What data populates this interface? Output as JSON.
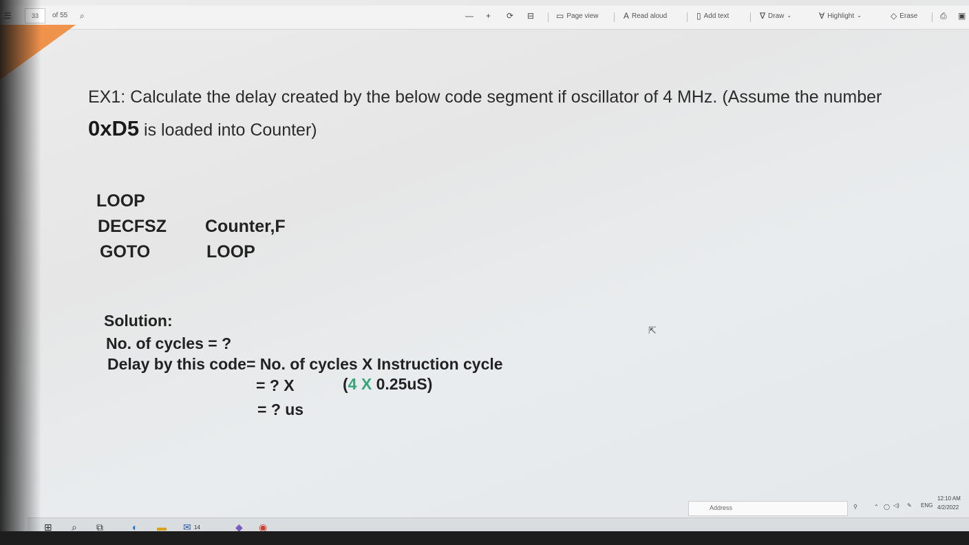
{
  "toolbar": {
    "page_current": "33",
    "page_total": "of 55",
    "zoom_out": "—",
    "zoom_in": "+",
    "page_view": "Page view",
    "read_aloud": "Read aloud",
    "add_text": "Add text",
    "draw": "Draw",
    "highlight": "Highlight",
    "erase": "Erase"
  },
  "document": {
    "question_line1": "EX1: Calculate the delay created by the below code segment if oscillator of 4 MHz. (Assume the number",
    "question_num": "0xD5",
    "question_line2": " is loaded into Counter)",
    "code": {
      "label": "LOOP",
      "row1_op": "DECFSZ",
      "row1_arg": "Counter,F",
      "row2_op": "GOTO",
      "row2_arg": "LOOP"
    },
    "solution": {
      "title": "Solution:",
      "line1": "No. of cycles = ?",
      "line2": "Delay by this code= No. of cycles X Instruction cycle",
      "line3_a": "= ?    X",
      "line3_b_open": "(",
      "line3_b_green": "4 X",
      "line3_b_rest": " 0.25uS)",
      "line4": "= ? us"
    }
  },
  "taskbar": {
    "address_label": "Address",
    "time": "12:10 AM",
    "date": "4/2/2022",
    "lang": "ENG",
    "badge": "14"
  }
}
